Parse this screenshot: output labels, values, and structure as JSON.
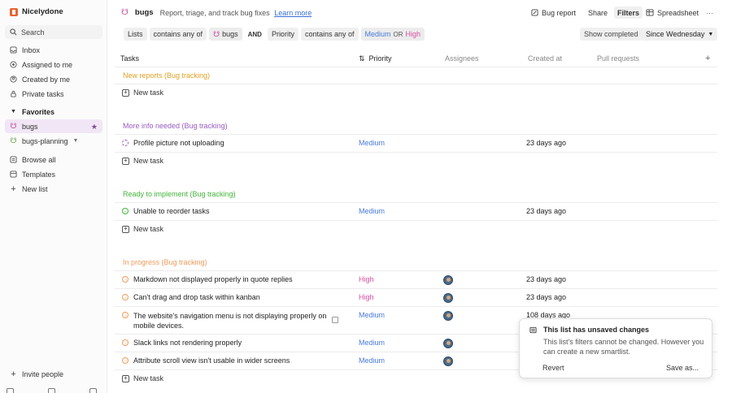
{
  "app": {
    "name": "Nicelydone"
  },
  "sidebar": {
    "search_label": "Search",
    "items": [
      {
        "label": "Inbox",
        "icon": "inbox-icon"
      },
      {
        "label": "Assigned to me",
        "icon": "target-icon"
      },
      {
        "label": "Created by me",
        "icon": "user-circle-icon"
      },
      {
        "label": "Private tasks",
        "icon": "lock-icon"
      }
    ],
    "favorites_title": "Favorites",
    "favorites": [
      {
        "label": "bugs",
        "active": true
      },
      {
        "label": "bugs-planning"
      }
    ],
    "browse_all": "Browse all",
    "templates": "Templates",
    "new_list": "New list",
    "invite": "Invite people"
  },
  "header": {
    "title": "bugs",
    "subtitle": "Report, triage, and track bug fixes",
    "learn_more": "Learn more",
    "bug_report": "Bug report",
    "share": "Share",
    "filters": "Filters",
    "spreadsheet": "Spreadsheet",
    "more": "···"
  },
  "filters": {
    "lists": "Lists",
    "contains_any_of_1": "contains any of",
    "bugs_value": "bugs",
    "and": "AND",
    "priority": "Priority",
    "contains_any_of_2": "contains any of",
    "medium": "Medium",
    "or": "OR",
    "high": "High",
    "show_completed": "Show completed",
    "since": "Since Wednesday"
  },
  "table": {
    "columns": {
      "tasks": "Tasks",
      "priority": "Priority",
      "assignees": "Assignees",
      "created_at": "Created at",
      "pull_requests": "Pull requests",
      "add": "+"
    },
    "new_task": "New task",
    "groups": [
      {
        "title": "New reports (Bug tracking)",
        "color": "#e0a020",
        "rows": []
      },
      {
        "title": "More info needed (Bug tracking)",
        "color": "#9a5bc4",
        "rows": [
          {
            "task": "Profile picture not uploading",
            "priority": "Medium",
            "created": "23 days ago"
          }
        ]
      },
      {
        "title": "Ready to implement (Bug tracking)",
        "color": "#43b53a",
        "rows": [
          {
            "task": "Unable to reorder tasks",
            "priority": "Medium",
            "created": "23 days ago"
          }
        ]
      },
      {
        "title": "In progress (Bug tracking)",
        "color": "#f09a5a",
        "rows": [
          {
            "task": "Markdown not displayed properly in quote replies",
            "priority": "High",
            "created": "23 days ago"
          },
          {
            "task": "Can't drag and drop task within kanban",
            "priority": "High",
            "created": "23 days ago"
          },
          {
            "task_line1": "The website's navigation menu is not displaying properly on",
            "task_line2": "mobile devices.",
            "priority": "Medium",
            "created": "108 days ago"
          },
          {
            "task": "Slack links not rendering properly",
            "priority": "Medium"
          },
          {
            "task": "Attribute scroll view isn't usable in wider screens",
            "priority": "Medium"
          }
        ]
      }
    ]
  },
  "popup": {
    "title": "This list has unsaved changes",
    "body": "This list's filters cannot be changed. However you can create a new smartlist.",
    "revert": "Revert",
    "save_as": "Save as..."
  },
  "colors": {
    "medium": "#4a7ad8",
    "high": "#d94fa3",
    "accent": "#7d4a8f"
  }
}
